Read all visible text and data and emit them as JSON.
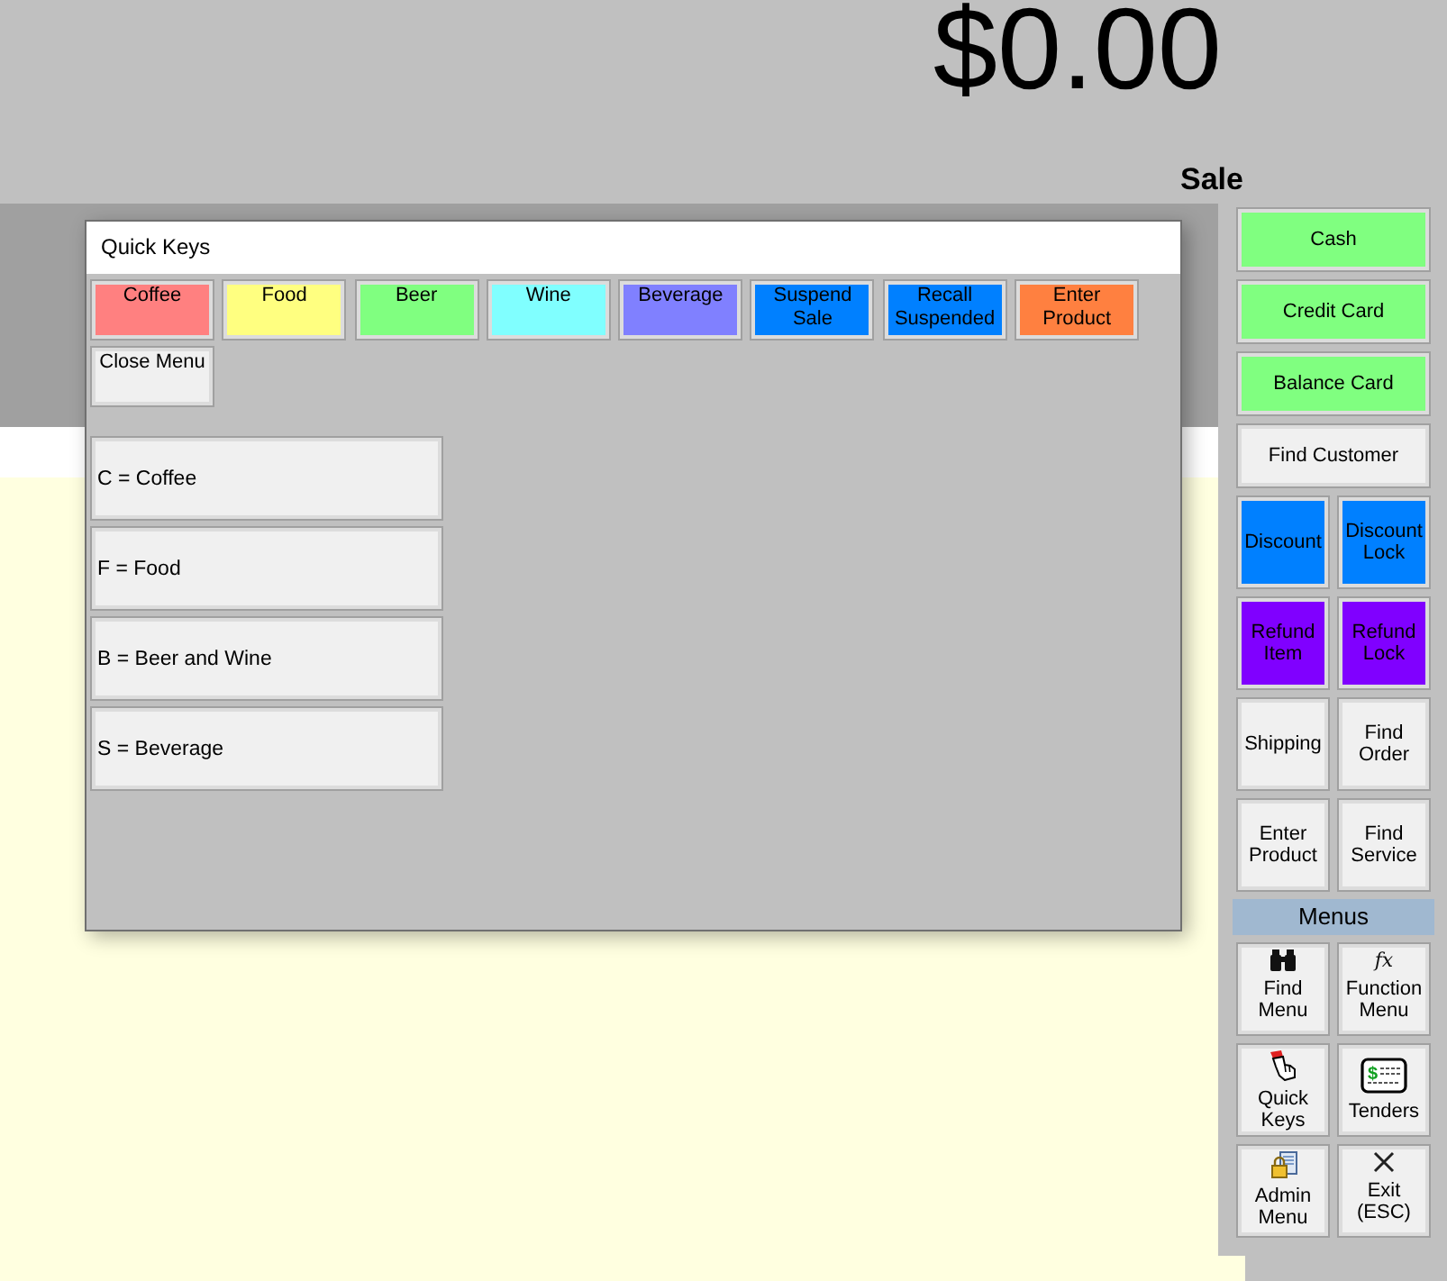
{
  "header": {
    "total": "$0.00",
    "mode": "Sale"
  },
  "quick_keys": {
    "title": "Quick Keys",
    "buttons": [
      {
        "label": "Coffee",
        "color": "#ff8080"
      },
      {
        "label": "Food",
        "color": "#ffff80"
      },
      {
        "label": "Beer",
        "color": "#80ff80"
      },
      {
        "label": "Wine",
        "color": "#80ffff"
      },
      {
        "label": "Beverage",
        "color": "#8080ff"
      },
      {
        "label": "Suspend Sale",
        "color": "#0080ff"
      },
      {
        "label": "Recall Suspended",
        "color": "#0080ff"
      },
      {
        "label": "Enter Product",
        "color": "#ff8040"
      }
    ],
    "close_button": "Close Menu",
    "shortcuts": [
      "C = Coffee",
      "F = Food",
      "B = Beer and Wine",
      "S = Beverage"
    ]
  },
  "side_panel": {
    "buttons": [
      {
        "label": "Cash",
        "kind": "wide",
        "color": "#80ff80"
      },
      {
        "label": "Credit Card",
        "kind": "wide",
        "color": "#80ff80"
      },
      {
        "label": "Balance Card",
        "kind": "wide",
        "color": "#80ff80"
      },
      {
        "label": "Find Customer",
        "kind": "wide",
        "color": "#f0f0f0"
      },
      {
        "label": "Discount",
        "kind": "half",
        "color": "#0080ff"
      },
      {
        "label": "Discount Lock",
        "kind": "half",
        "color": "#0080ff"
      },
      {
        "label": "Refund Item",
        "kind": "half",
        "color": "#8000ff"
      },
      {
        "label": "Refund Lock",
        "kind": "half",
        "color": "#8000ff"
      },
      {
        "label": "Shipping",
        "kind": "half",
        "color": "#f0f0f0"
      },
      {
        "label": "Find Order",
        "kind": "half",
        "color": "#f0f0f0"
      },
      {
        "label": "Enter Product",
        "kind": "half",
        "color": "#f0f0f0"
      },
      {
        "label": "Find Service",
        "kind": "half",
        "color": "#f0f0f0"
      }
    ],
    "menus_title": "Menus",
    "menu_buttons": [
      {
        "label": "Find Menu"
      },
      {
        "label": "Function Menu"
      },
      {
        "label": "Quick Keys"
      },
      {
        "label": "Tenders"
      },
      {
        "label": "Admin Menu"
      },
      {
        "label": "Exit (ESC)"
      }
    ],
    "icon_glyphs": [
      "fx",
      "$"
    ]
  }
}
